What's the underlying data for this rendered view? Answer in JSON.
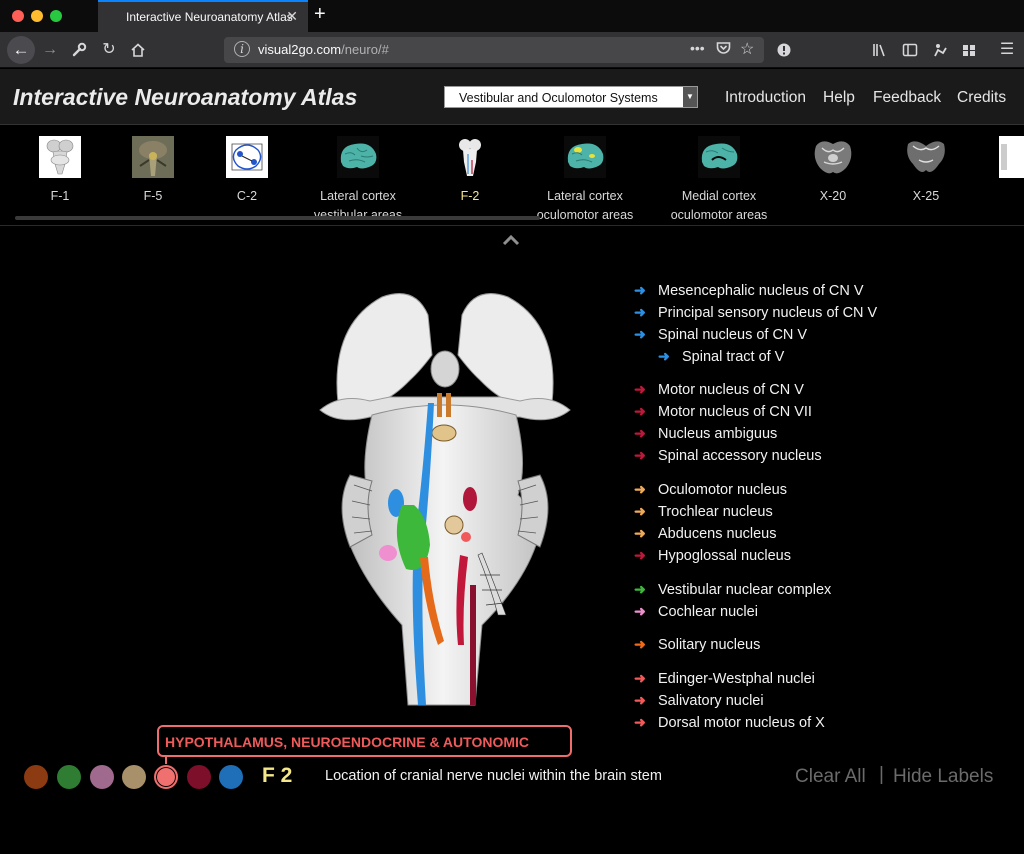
{
  "browser": {
    "tab_title": "Interactive Neuroanatomy Atlas",
    "tab_close": "✕",
    "new_tab": "+",
    "url_host": "visual2go.com",
    "url_path": "/neuro/#",
    "url_info": "i",
    "page_actions": "•••"
  },
  "header": {
    "title": "Interactive Neuroanatomy Atlas",
    "system_select": "Vestibular and Oculomotor Systems",
    "nav": [
      "Introduction",
      "Help",
      "Feedback",
      "Credits"
    ]
  },
  "thumbnails": [
    {
      "line1": "F-1",
      "line2": "",
      "kind": "brainstem-small",
      "active": false
    },
    {
      "line1": "F-5",
      "line2": "",
      "kind": "photo",
      "active": false
    },
    {
      "line1": "C-2",
      "line2": "",
      "kind": "diagram",
      "active": false
    },
    {
      "line1": "Lateral cortex",
      "line2": "vestibular areas",
      "kind": "cortex",
      "active": false
    },
    {
      "line1": "F-2",
      "line2": "",
      "kind": "brainstem-small",
      "active": true
    },
    {
      "line1": "Lateral cortex",
      "line2": "oculomotor areas",
      "kind": "cortex",
      "active": false
    },
    {
      "line1": "Medial cortex",
      "line2": "oculomotor areas",
      "kind": "cortex",
      "active": false
    },
    {
      "line1": "X-20",
      "line2": "",
      "kind": "section",
      "active": false
    },
    {
      "line1": "X-25",
      "line2": "",
      "kind": "section",
      "active": false
    }
  ],
  "legend": [
    {
      "label": "Mesencephalic nucleus of CN V",
      "color": "#2e8fe0",
      "indent": false
    },
    {
      "label": "Principal sensory nucleus of CN V",
      "color": "#2e8fe0",
      "indent": false
    },
    {
      "label": "Spinal nucleus of CN V",
      "color": "#2e8fe0",
      "indent": false
    },
    {
      "label": "Spinal tract of V",
      "color": "#2e8fe0",
      "indent": true
    },
    {
      "label": "Motor nucleus of CN V",
      "color": "#c0173a",
      "indent": false
    },
    {
      "label": "Motor nucleus of CN VII",
      "color": "#c0173a",
      "indent": false
    },
    {
      "label": "Nucleus ambiguus",
      "color": "#c0173a",
      "indent": false
    },
    {
      "label": "Spinal accessory nucleus",
      "color": "#c0173a",
      "indent": false
    },
    {
      "label": "Oculomotor nucleus",
      "color": "#f0a955",
      "indent": false
    },
    {
      "label": "Trochlear nucleus",
      "color": "#f0a955",
      "indent": false
    },
    {
      "label": "Abducens nucleus",
      "color": "#f0a955",
      "indent": false
    },
    {
      "label": "Hypoglossal nucleus",
      "color": "#c0173a",
      "indent": false
    },
    {
      "label": "Vestibular nuclear complex",
      "color": "#3db83a",
      "indent": false
    },
    {
      "label": "Cochlear nuclei",
      "color": "#f08fcf",
      "indent": false
    },
    {
      "label": "Solitary nucleus",
      "color": "#f06a1a",
      "indent": false
    },
    {
      "label": "Edinger-Westphal nuclei",
      "color": "#f05a5a",
      "indent": false
    },
    {
      "label": "Salivatory nuclei",
      "color": "#f05a5a",
      "indent": false
    },
    {
      "label": "Dorsal motor nucleus of X",
      "color": "#f05a5a",
      "indent": false
    }
  ],
  "tooltip": "HYPOTHALAMUS, NEUROENDOCRINE & AUTONOMIC",
  "swatches": [
    {
      "color": "#8b3a12",
      "active": false
    },
    {
      "color": "#2e7d32",
      "active": false
    },
    {
      "color": "#a06a8e",
      "active": false
    },
    {
      "color": "#a8916a",
      "active": false
    },
    {
      "color": "#f06f6f",
      "active": true
    },
    {
      "color": "#7d0f2a",
      "active": false
    },
    {
      "color": "#1e6fb8",
      "active": false
    }
  ],
  "figure": {
    "code": "F 2",
    "caption": "Location of cranial nerve nuclei within the brain stem"
  },
  "actions": {
    "clear_all": "Clear All",
    "separator": "|",
    "hide_labels": "Hide Labels"
  },
  "colors": {
    "accent_tab": "#0a84ff",
    "active_label": "#f5e88a",
    "tooltip": "#ef6d6d"
  }
}
